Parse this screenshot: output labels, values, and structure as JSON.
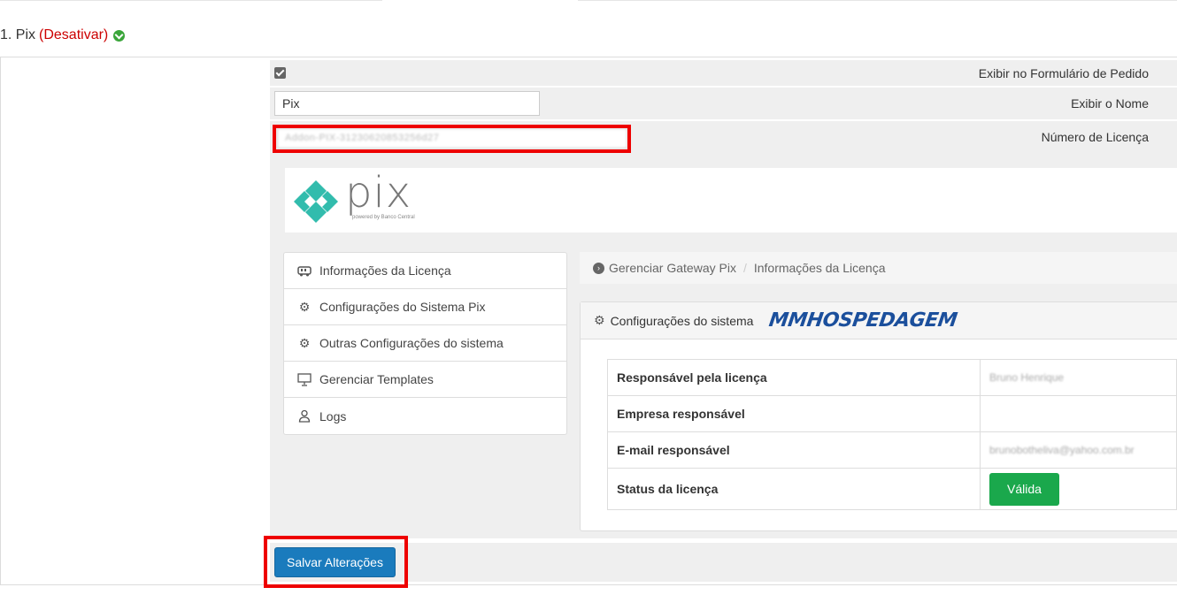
{
  "heading": {
    "title": "1. Pix",
    "deactivate_link": "(Desativar)"
  },
  "form": {
    "show_in_order_form_label": "Exibir no Formulário de Pedido",
    "show_in_order_form_checked": true,
    "display_name_label": "Exibir o Nome",
    "display_name_value": "Pix",
    "license_label": "Número de Licença",
    "license_value": "Addon-PIX-31230620853256d27"
  },
  "logo": {
    "word": "pix",
    "subtitle": "powered by Banco Central"
  },
  "menu": {
    "items": [
      {
        "label": "Informações da Licença",
        "icon": "license-icon"
      },
      {
        "label": "Configurações do Sistema Pix",
        "icon": "gear-icon"
      },
      {
        "label": "Outras Configurações do sistema",
        "icon": "gear-icon"
      },
      {
        "label": "Gerenciar Templates",
        "icon": "presentation-icon"
      },
      {
        "label": "Logs",
        "icon": "user-icon"
      }
    ]
  },
  "breadcrumb": {
    "root": "Gerenciar Gateway Pix",
    "separator": "/",
    "current": "Informações da Licença"
  },
  "config": {
    "title": "Configurações do sistema",
    "brand": "MMHOSPEDAGEM",
    "rows": [
      {
        "key": "Responsável pela licença",
        "value": "Bruno Henrique"
      },
      {
        "key": "Empresa responsável",
        "value": ""
      },
      {
        "key": "E-mail responsável",
        "value": "brunobotheliva@yahoo.com.br"
      },
      {
        "key": "Status da licença",
        "value": "Válida"
      }
    ]
  },
  "actions": {
    "save_label": "Salvar Alterações"
  },
  "colors": {
    "deactivate": "#cc0000",
    "save_button": "#1a7bbd",
    "status_valid": "#1aa84c",
    "highlight_box": "#ee0000",
    "pix_teal": "#32bcad"
  }
}
